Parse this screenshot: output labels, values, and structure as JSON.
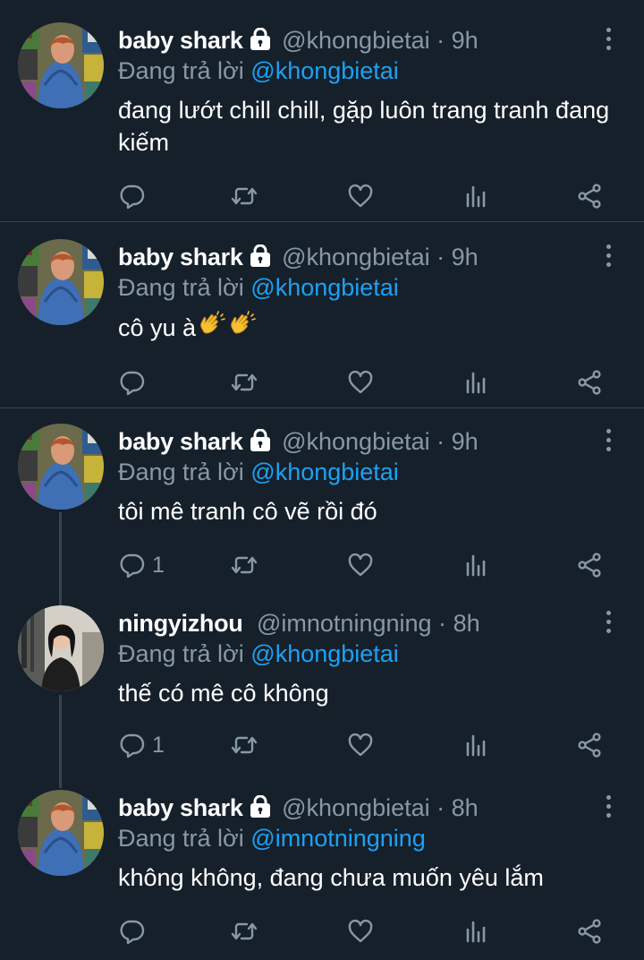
{
  "colors": {
    "background": "#15202b",
    "text": "#ffffff",
    "muted": "#8899a6",
    "link": "#1da1f2",
    "divider": "#38444d"
  },
  "icons": {
    "reply": "comment-bubble-icon",
    "retweet": "retweet-icon",
    "like": "heart-icon",
    "stats": "bar-chart-icon",
    "share": "share-icon",
    "menu": "vertical-dots-icon",
    "lock": "lock-icon",
    "emoji": "clapping-hands-emoji"
  },
  "tweets": [
    {
      "name": "baby shark",
      "handle": "@khongbietai",
      "dot": "·",
      "time": "9h",
      "reply_prefix": "Đang trả lời",
      "reply_to": "@khongbietai",
      "text": "đang lướt chill chill, gặp luôn trang tranh đang kiếm",
      "reply_count": ""
    },
    {
      "name": "baby shark",
      "handle": "@khongbietai",
      "dot": "·",
      "time": "9h",
      "reply_prefix": "Đang trả lời",
      "reply_to": "@khongbietai",
      "text": "cô yu à",
      "reply_count": ""
    },
    {
      "name": "baby shark",
      "handle": "@khongbietai",
      "dot": "·",
      "time": "9h",
      "reply_prefix": "Đang trả lời",
      "reply_to": "@khongbietai",
      "text": "tôi mê tranh cô vẽ rồi đó",
      "reply_count": "1"
    },
    {
      "name": "ningyizhou",
      "handle": "@imnotningning",
      "dot": "·",
      "time": "8h",
      "reply_prefix": "Đang trả lời",
      "reply_to": "@khongbietai",
      "text": "thế có mê cô không",
      "reply_count": "1"
    },
    {
      "name": "baby shark",
      "handle": "@khongbietai",
      "dot": "·",
      "time": "8h",
      "reply_prefix": "Đang trả lời",
      "reply_to": "@imnotningning",
      "text": "không không, đang chưa muốn yêu lắm",
      "reply_count": ""
    }
  ]
}
